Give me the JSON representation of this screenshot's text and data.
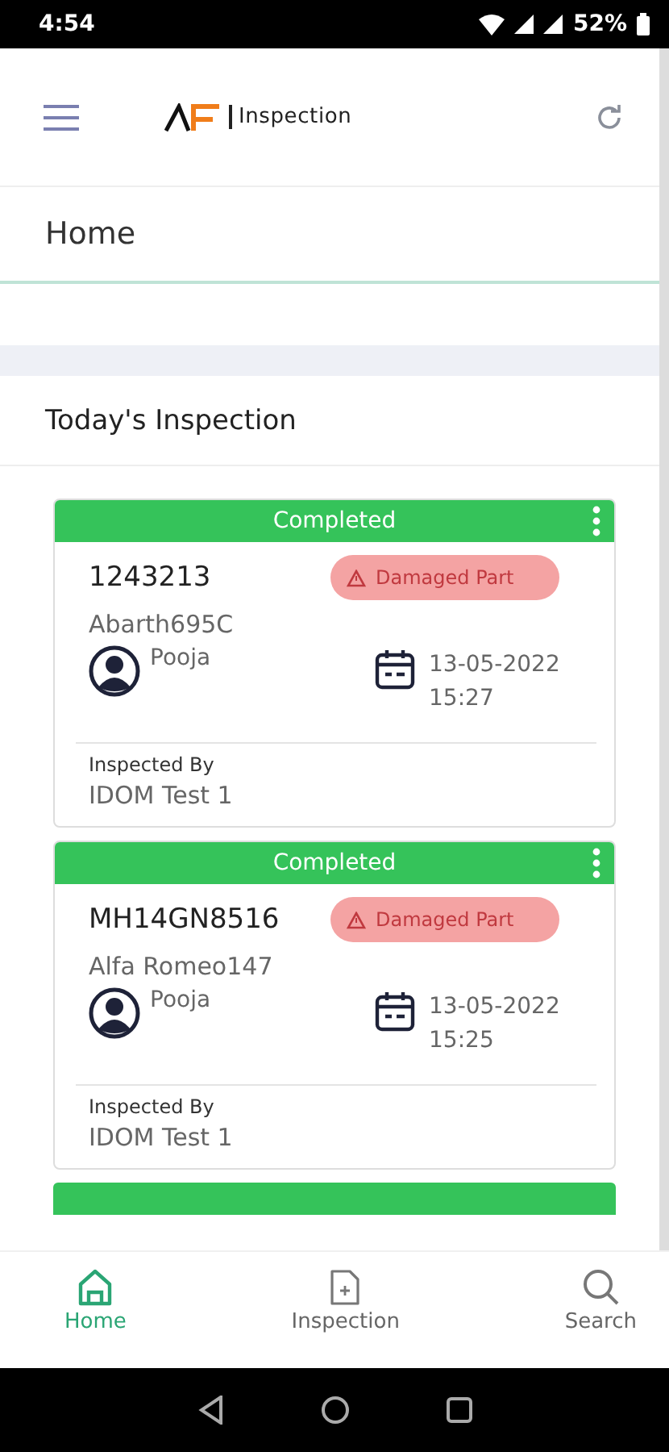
{
  "status_bar": {
    "time": "4:54",
    "battery": "52%"
  },
  "app_bar": {
    "logo_text": "Inspection"
  },
  "page_title": "Home",
  "section_title": "Today's Inspection",
  "cards": [
    {
      "status": "Completed",
      "number": "1243213",
      "tag": "Damaged Part",
      "model": "Abarth695C",
      "owner": "Pooja",
      "date": "13-05-2022",
      "time": "15:27",
      "inspected_by_label": "Inspected By",
      "inspector": "IDOM Test 1"
    },
    {
      "status": "Completed",
      "number": "MH14GN8516",
      "tag": "Damaged Part",
      "model": "Alfa Romeo147",
      "owner": "Pooja",
      "date": "13-05-2022",
      "time": "15:25",
      "inspected_by_label": "Inspected By",
      "inspector": "IDOM Test 1"
    }
  ],
  "more_cards_below": true,
  "bottom_nav": [
    {
      "kind": "home",
      "label": "Home",
      "selected": true
    },
    {
      "kind": "inspection",
      "label": "Inspection",
      "selected": false
    },
    {
      "kind": "search",
      "label": "Search",
      "selected": false
    }
  ]
}
